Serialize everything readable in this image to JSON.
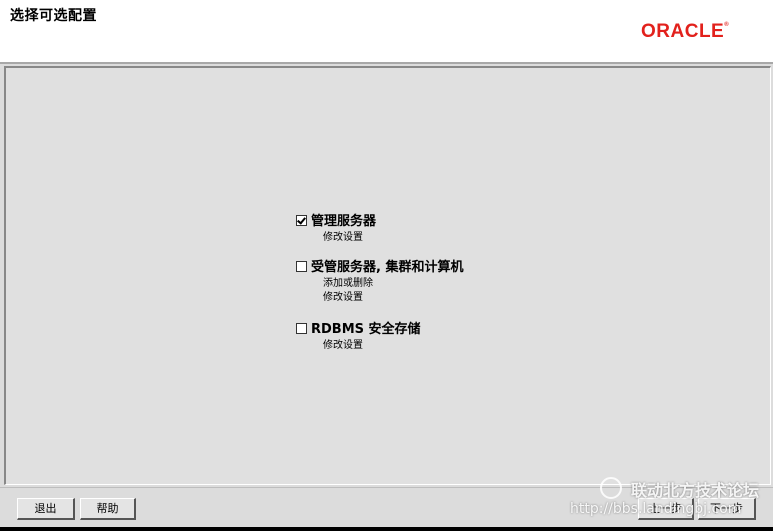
{
  "header": {
    "title": "选择可选配置",
    "logo_text": "ORACLE"
  },
  "options": [
    {
      "label": "管理服务器",
      "checked": true,
      "sub": [
        "修改设置"
      ]
    },
    {
      "label": "受管服务器, 集群和计算机",
      "checked": false,
      "sub": [
        "添加或删除",
        "修改设置"
      ]
    },
    {
      "label": "RDBMS 安全存储",
      "checked": false,
      "sub": [
        "修改设置"
      ]
    }
  ],
  "footer": {
    "exit_label": "退出",
    "help_label": "帮助",
    "back_label": "上一步",
    "next_label": "下一步"
  },
  "watermark": {
    "line1": "联动北方技术论坛",
    "line2": "http://bbs.landingbj.com"
  },
  "colors": {
    "brand": "#e2211c",
    "background": "#e0e0e0"
  },
  "icons": [
    "checkbox-icon",
    "watermark-logo-icon"
  ]
}
